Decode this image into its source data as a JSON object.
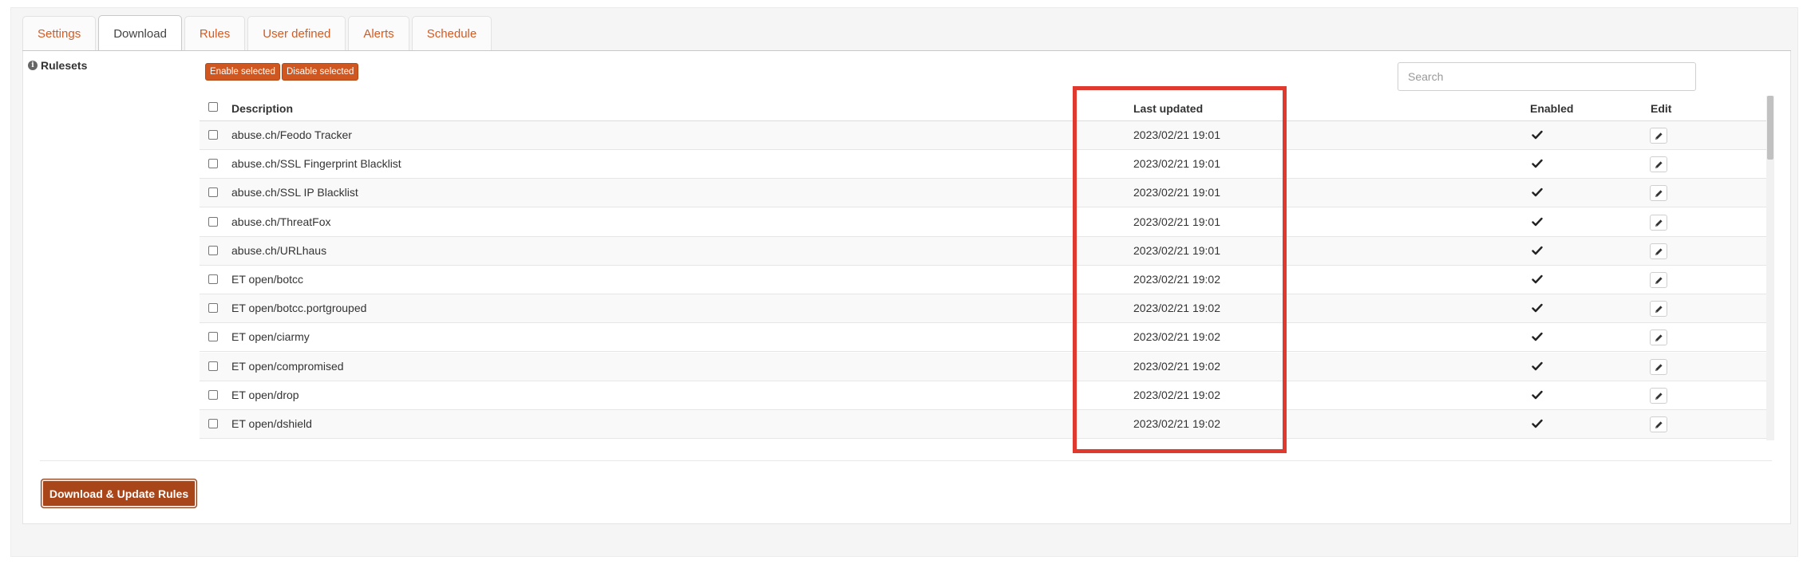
{
  "tabs": [
    "Settings",
    "Download",
    "Rules",
    "User defined",
    "Alerts",
    "Schedule"
  ],
  "active_tab": "Download",
  "section_label": "Rulesets",
  "buttons": {
    "enable_selected": "Enable selected",
    "disable_selected": "Disable selected",
    "download_update": "Download & Update Rules"
  },
  "search": {
    "placeholder": "Search",
    "value": ""
  },
  "table": {
    "headers": {
      "description": "Description",
      "last_updated": "Last updated",
      "enabled": "Enabled",
      "edit": "Edit"
    },
    "rows": [
      {
        "description": "abuse.ch/Feodo Tracker",
        "last_updated": "2023/02/21 19:01",
        "enabled": true
      },
      {
        "description": "abuse.ch/SSL Fingerprint Blacklist",
        "last_updated": "2023/02/21 19:01",
        "enabled": true
      },
      {
        "description": "abuse.ch/SSL IP Blacklist",
        "last_updated": "2023/02/21 19:01",
        "enabled": true
      },
      {
        "description": "abuse.ch/ThreatFox",
        "last_updated": "2023/02/21 19:01",
        "enabled": true
      },
      {
        "description": "abuse.ch/URLhaus",
        "last_updated": "2023/02/21 19:01",
        "enabled": true
      },
      {
        "description": "ET open/botcc",
        "last_updated": "2023/02/21 19:02",
        "enabled": true
      },
      {
        "description": "ET open/botcc.portgrouped",
        "last_updated": "2023/02/21 19:02",
        "enabled": true
      },
      {
        "description": "ET open/ciarmy",
        "last_updated": "2023/02/21 19:02",
        "enabled": true
      },
      {
        "description": "ET open/compromised",
        "last_updated": "2023/02/21 19:02",
        "enabled": true
      },
      {
        "description": "ET open/drop",
        "last_updated": "2023/02/21 19:02",
        "enabled": true
      },
      {
        "description": "ET open/dshield",
        "last_updated": "2023/02/21 19:02",
        "enabled": true
      }
    ]
  },
  "colors": {
    "accent": "#d35b23",
    "button_dark": "#a8461a",
    "highlight": "#e03a2f"
  },
  "icons": {
    "info": "info-circle-icon",
    "enabled": "check-icon",
    "edit": "pencil-icon"
  }
}
